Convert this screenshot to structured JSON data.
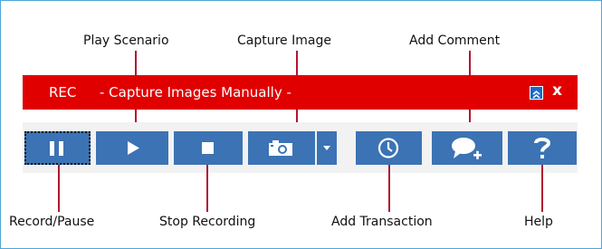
{
  "toolbar": {
    "title_prefix": "REC",
    "title_mode": "- Capture Images Manually -",
    "collapse_icon": "double-chevron-up-icon",
    "close_label": "x"
  },
  "buttons": [
    {
      "id": "record-pause",
      "icon": "pause-icon"
    },
    {
      "id": "play-scenario",
      "icon": "play-icon"
    },
    {
      "id": "stop-recording",
      "icon": "stop-icon"
    },
    {
      "id": "capture-image",
      "icon": "camera-icon"
    },
    {
      "id": "capture-image-dropdown",
      "icon": "caret-down-icon"
    },
    {
      "id": "add-transaction",
      "icon": "clock-icon"
    },
    {
      "id": "add-comment",
      "icon": "speech-bubble-plus-icon"
    },
    {
      "id": "help",
      "icon": "question-mark-icon"
    }
  ],
  "callouts": {
    "play_scenario": "Play Scenario",
    "capture_image": "Capture Image",
    "add_comment": "Add Comment",
    "record_pause": "Record/Pause",
    "stop_recording": "Stop Recording",
    "add_transaction": "Add Transaction",
    "help": "Help"
  },
  "colors": {
    "title_bar": "#e00000",
    "button_fill": "#3b73b4",
    "leader_line": "#b0182e",
    "frame_border": "#4ea6d6"
  }
}
